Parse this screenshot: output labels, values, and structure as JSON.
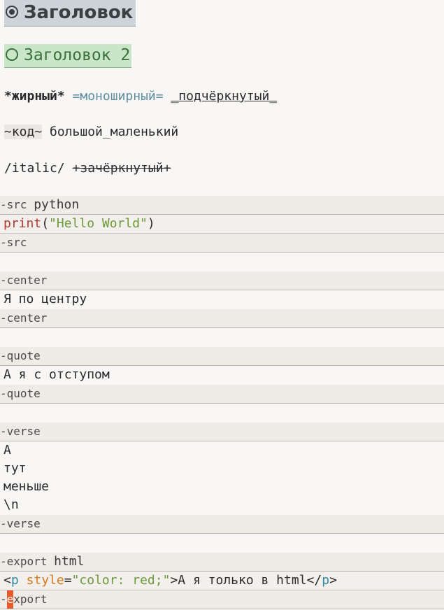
{
  "headings": {
    "h1": "Заголовок",
    "h2": "Заголовок 2"
  },
  "line1": {
    "bold": "*жирный*",
    "mono": "=моноширный=",
    "underline": "_подчёркнутый_"
  },
  "line2": {
    "code": "~код~",
    "text": "большой_маленький"
  },
  "line3": {
    "italic": "/italic/",
    "strike": "+зачёркнутый+"
  },
  "src_block": {
    "begin_keyword": "src",
    "language": "python",
    "code_fn": "print",
    "code_open": "(",
    "code_string": "\"Hello World\"",
    "code_close": ")",
    "end_keyword": "src"
  },
  "center_block": {
    "begin_keyword": "center",
    "content": "Я по центру",
    "end_keyword": "center"
  },
  "quote_block": {
    "begin_keyword": "quote",
    "content": "А я с отступом",
    "end_keyword": "quote"
  },
  "verse_block": {
    "begin_keyword": "verse",
    "lines": [
      "А",
      "тут",
      "меньше",
      "\\n"
    ],
    "end_keyword": "verse"
  },
  "export_block": {
    "begin_keyword": "export",
    "language": "html",
    "lt": "<",
    "tag": "p",
    "attr": "style",
    "eq": "=",
    "attr_value": "\"color: red;\"",
    "gt": ">",
    "inner_text": "А я только в html",
    "close_lt": "</",
    "close_tag": "p",
    "close_gt": ">",
    "end_cursor_char": "e",
    "end_rest": "xport"
  },
  "colors": {
    "background": "#f8f7f5",
    "block_background": "#efebe7",
    "h1_background": "#cdd4d8",
    "h2_background": "#c9e6c9",
    "cursor": "#e85a2a"
  }
}
